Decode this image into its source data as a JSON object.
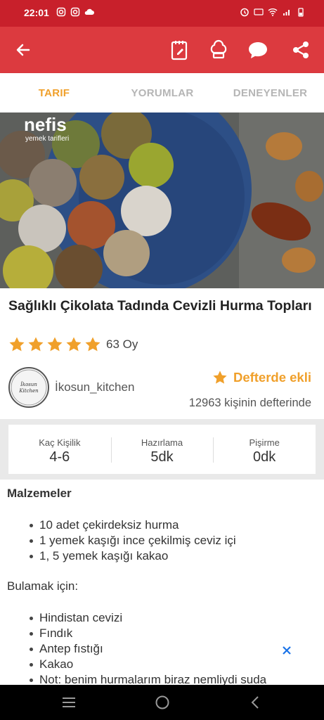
{
  "status_bar": {
    "time": "22:01"
  },
  "tabs": [
    {
      "label": "TARIF",
      "active": true
    },
    {
      "label": "YORUMLAR",
      "active": false
    },
    {
      "label": "DENEYENLER",
      "active": false
    }
  ],
  "hero": {
    "brand": "nefis",
    "brand_sub": "yemek tarifleri"
  },
  "recipe": {
    "title": "Sağlıklı Çikolata Tadında Cevizli Hurma Topları",
    "rating_stars": 5,
    "rating_count": "63 Oy"
  },
  "author": {
    "name": "İkosun_kitchen",
    "avatar_text": "İkosun Kitchen"
  },
  "notebook": {
    "label": "Defterde ekli",
    "count_text": "12963 kişinin defterinde"
  },
  "stats": [
    {
      "label": "Kaç Kişilik",
      "value": "4-6"
    },
    {
      "label": "Hazırlama",
      "value": "5dk"
    },
    {
      "label": "Pişirme",
      "value": "0dk"
    }
  ],
  "ingredients": {
    "heading": "Malzemeler",
    "items": [
      "10 adet çekirdeksiz hurma",
      "1 yemek kaşığı ince çekilmiş ceviz içi",
      "1, 5 yemek kaşığı kakao"
    ],
    "coating_heading": "Bulamak için:",
    "coating_items": [
      "Hindistan cevizi",
      "Fındık",
      "Antep fıstığı",
      "Kakao",
      "Not: benim hurmalarım biraz nemliydi suda"
    ]
  },
  "colors": {
    "primary": "#dc3a3f",
    "status": "#c8202b",
    "accent": "#f0a02b"
  },
  "icons": [
    "back-icon",
    "notebook-icon",
    "chef-hat-icon",
    "comment-icon",
    "share-icon",
    "star-icon",
    "close-icon",
    "menu-icon",
    "home-icon",
    "back-nav-icon"
  ]
}
